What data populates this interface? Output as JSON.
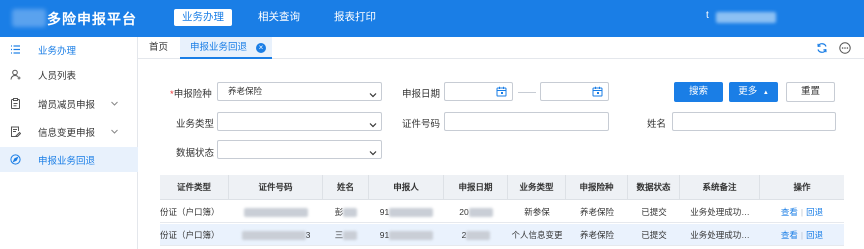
{
  "app": {
    "title": "多险申报平台",
    "user_prefix": "t"
  },
  "topnav": {
    "items": [
      {
        "label": "业务办理",
        "active": true
      },
      {
        "label": "相关查询",
        "active": false
      },
      {
        "label": "报表打印",
        "active": false
      }
    ]
  },
  "sidebar": {
    "items": [
      {
        "label": "业务办理",
        "icon": "list-icon",
        "state": "header",
        "chevron": false
      },
      {
        "label": "人员列表",
        "icon": "person-icon",
        "state": "normal",
        "chevron": false
      },
      {
        "label": "增员减员申报",
        "icon": "clipboard-icon",
        "state": "normal",
        "chevron": true
      },
      {
        "label": "信息变更申报",
        "icon": "edit-document-icon",
        "state": "normal",
        "chevron": true
      },
      {
        "label": "申报业务回退",
        "icon": "compass-icon",
        "state": "active",
        "chevron": false
      }
    ]
  },
  "tabs": {
    "home": "首页",
    "active": "申报业务回退",
    "close_symbol": "⊗"
  },
  "form": {
    "insurance_type": {
      "label": "申报险种",
      "required_mark": "*",
      "value": "养老保险"
    },
    "declare_date": {
      "label": "申报日期",
      "from": "",
      "to": ""
    },
    "business_type": {
      "label": "业务类型",
      "value": ""
    },
    "id_number": {
      "label": "证件号码",
      "value": ""
    },
    "name": {
      "label": "姓名",
      "value": ""
    },
    "data_status": {
      "label": "数据状态",
      "value": ""
    }
  },
  "buttons": {
    "search": "搜索",
    "more": "更多",
    "more_caret": "▲",
    "reset": "重置"
  },
  "table": {
    "columns": [
      "证件类型",
      "证件号码",
      "姓名",
      "申报人",
      "申报日期",
      "业务类型",
      "申报险种",
      "数据状态",
      "系统备注",
      "操作"
    ],
    "rows": [
      {
        "id_type": "份证（户口簿）",
        "id_number_tail": "",
        "name_head": "彭",
        "declarant_head": "91",
        "date_head": "20",
        "business_type": "新参保",
        "insurance": "养老保险",
        "status": "已提交",
        "remark": "业务处理成功…",
        "action_view": "查看",
        "action_sep": "|",
        "action_back": "回退"
      },
      {
        "id_type": "份证（户口簿）",
        "id_number_tail": "3",
        "name_head": "三",
        "declarant_head": "91",
        "date_head": "2",
        "business_type": "个人信息变更",
        "insurance": "养老保险",
        "status": "已提交",
        "remark": "业务处理成功…",
        "action_view": "查看",
        "action_sep": "|",
        "action_back": "回退"
      }
    ]
  },
  "colors": {
    "primary": "#1a7ee6",
    "active_bg": "#e8f1fc",
    "required": "#e33333"
  }
}
